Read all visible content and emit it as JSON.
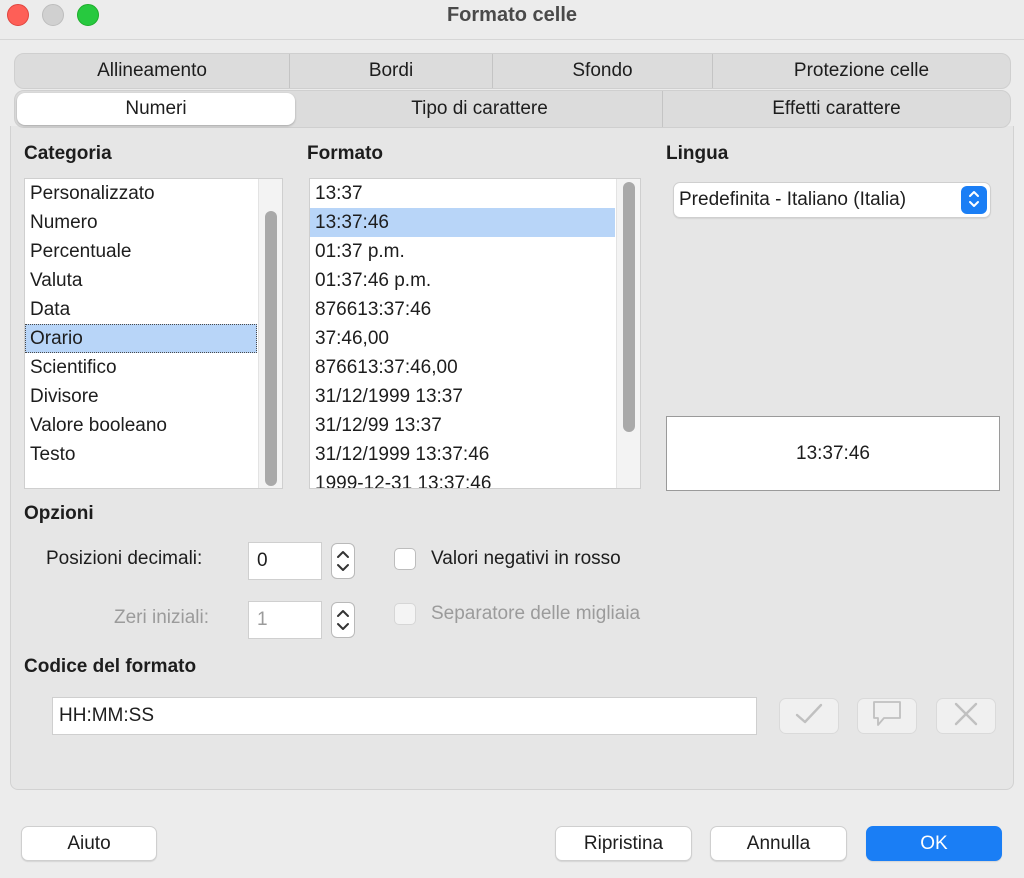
{
  "window": {
    "title": "Formato celle"
  },
  "tabs": {
    "row1": [
      "Allineamento",
      "Bordi",
      "Sfondo",
      "Protezione celle"
    ],
    "row2": [
      "Numeri",
      "Tipo di carattere",
      "Effetti carattere"
    ],
    "active": "Numeri"
  },
  "categoria": {
    "label": "Categoria",
    "items": [
      "Personalizzato",
      "Numero",
      "Percentuale",
      "Valuta",
      "Data",
      "Orario",
      "Scientifico",
      "Divisore",
      "Valore booleano",
      "Testo"
    ],
    "selected": "Orario"
  },
  "formato": {
    "label": "Formato",
    "items": [
      "13:37",
      "13:37:46",
      "01:37 p.m.",
      "01:37:46 p.m.",
      "876613:37:46",
      "37:46,00",
      "876613:37:46,00",
      "31/12/1999 13:37",
      "31/12/99 13:37",
      "31/12/1999 13:37:46",
      "1999-12-31 13:37:46"
    ],
    "selected": "13:37:46"
  },
  "lingua": {
    "label": "Lingua",
    "value": "Predefinita - Italiano (Italia)"
  },
  "preview": {
    "value": "13:37:46"
  },
  "opzioni": {
    "label": "Opzioni",
    "decimali_label": "Posizioni decimali:",
    "decimali_value": "0",
    "zeri_label": "Zeri iniziali:",
    "zeri_value": "1",
    "negativi_label": "Valori negativi in rosso",
    "negativi_checked": false,
    "migliaia_label": "Separatore delle migliaia",
    "migliaia_checked": false
  },
  "codice": {
    "label": "Codice del formato",
    "value": "HH:MM:SS"
  },
  "buttons": {
    "help": "Aiuto",
    "reset": "Ripristina",
    "cancel": "Annulla",
    "ok": "OK"
  },
  "colors": {
    "accent": "#1a7ef5",
    "selection": "#b8d5f8",
    "close": "#fe5f57",
    "maximize": "#27c93f"
  },
  "icons": {
    "accept": "checkmark-icon",
    "comment": "speech-bubble-icon",
    "delete": "x-mark-icon",
    "select": "updown-chevron-icon"
  }
}
